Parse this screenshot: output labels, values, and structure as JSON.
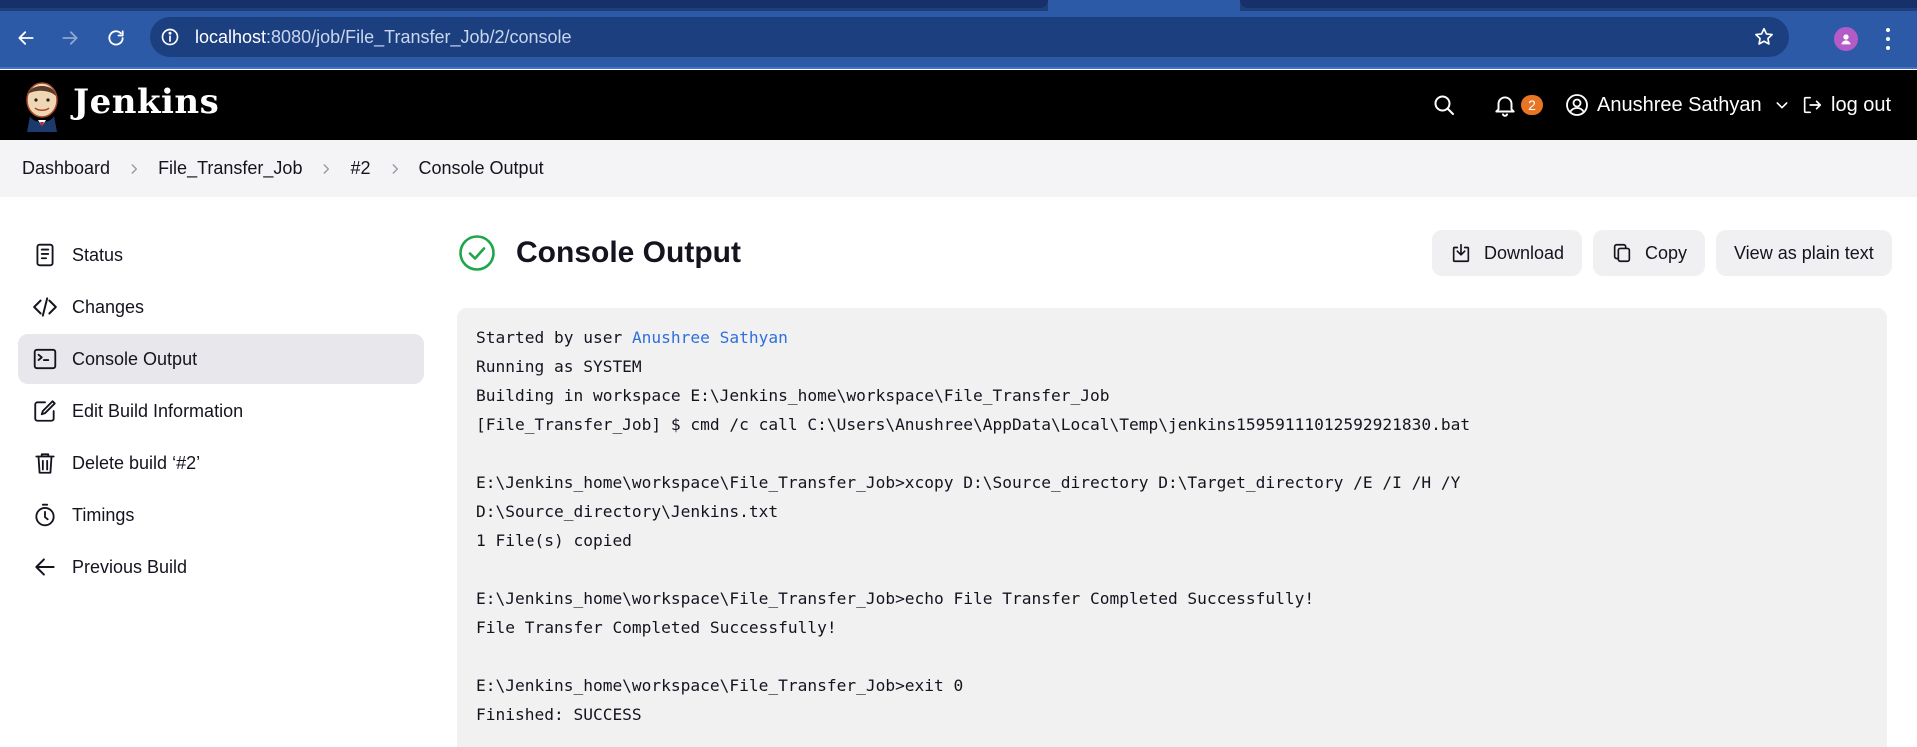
{
  "browser": {
    "url_host": "localhost",
    "url_path": ":8080/job/File_Transfer_Job/2/console",
    "back_icon": "arrow-left-icon",
    "forward_icon": "arrow-right-icon",
    "reload_icon": "reload-icon",
    "bookmark_icon": "star-icon"
  },
  "header": {
    "brand": "Jenkins",
    "notification_count": "2",
    "user_name": "Anushree Sathyan",
    "logout_label": "log out",
    "accent_color": "#e87524"
  },
  "breadcrumb": {
    "items": [
      "Dashboard",
      "File_Transfer_Job",
      "#2",
      "Console Output"
    ]
  },
  "sidebar": {
    "items": [
      {
        "label": "Status",
        "icon": "document-icon",
        "active": false
      },
      {
        "label": "Changes",
        "icon": "code-icon",
        "active": false
      },
      {
        "label": "Console Output",
        "icon": "terminal-icon",
        "active": true
      },
      {
        "label": "Edit Build Information",
        "icon": "edit-icon",
        "active": false
      },
      {
        "label": "Delete build ‘#2’",
        "icon": "trash-icon",
        "active": false
      },
      {
        "label": "Timings",
        "icon": "stopwatch-icon",
        "active": false
      },
      {
        "label": "Previous Build",
        "icon": "arrow-left-icon",
        "active": false
      }
    ]
  },
  "main": {
    "title": "Console Output",
    "status_color": "#1ea64b",
    "actions": {
      "download_label": "Download",
      "copy_label": "Copy",
      "plain_text_label": "View as plain text"
    },
    "console": {
      "started_prefix": "Started by user ",
      "started_user": "Anushree Sathyan",
      "lines": [
        "Running as SYSTEM",
        "Building in workspace E:\\Jenkins_home\\workspace\\File_Transfer_Job",
        "[File_Transfer_Job] $ cmd /c call C:\\Users\\Anushree\\AppData\\Local\\Temp\\jenkins15959111012592921830.bat",
        "",
        "E:\\Jenkins_home\\workspace\\File_Transfer_Job>xcopy D:\\Source_directory D:\\Target_directory /E /I /H /Y",
        "D:\\Source_directory\\Jenkins.txt",
        "1 File(s) copied",
        "",
        "E:\\Jenkins_home\\workspace\\File_Transfer_Job>echo File Transfer Completed Successfully!",
        "File Transfer Completed Successfully!",
        "",
        "E:\\Jenkins_home\\workspace\\File_Transfer_Job>exit 0",
        "Finished: SUCCESS"
      ]
    }
  }
}
